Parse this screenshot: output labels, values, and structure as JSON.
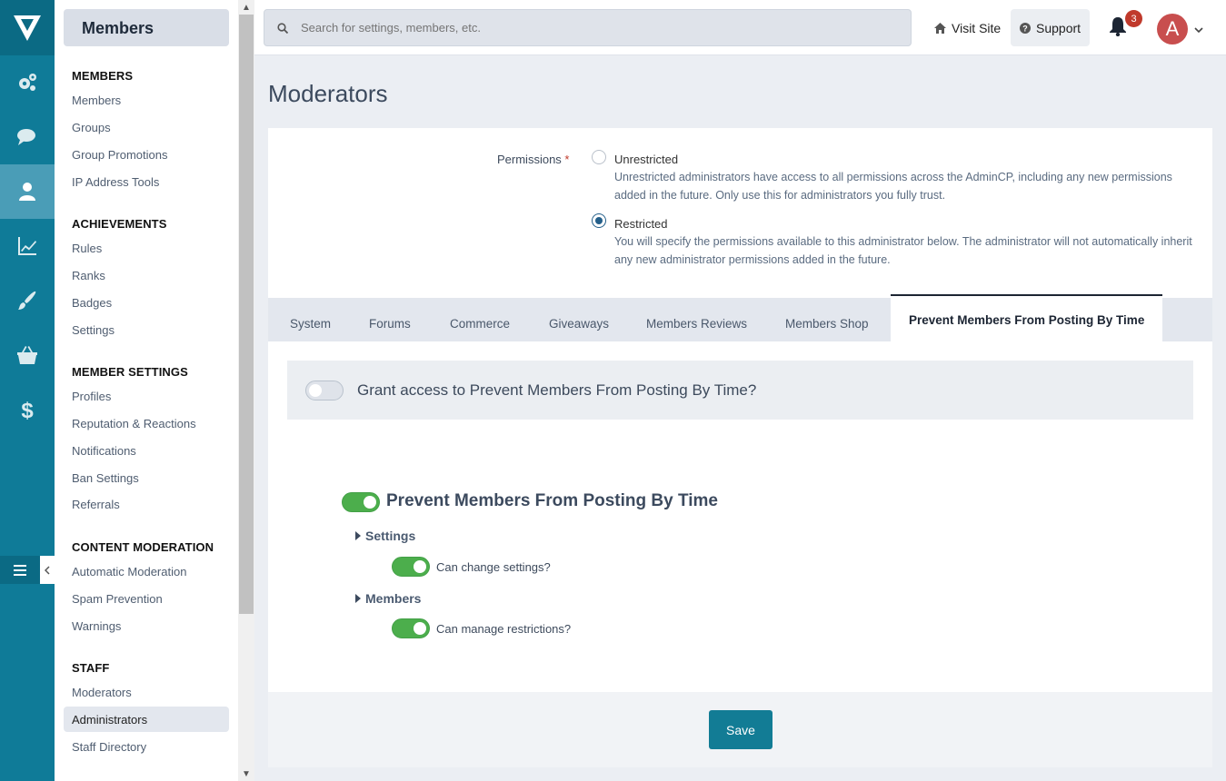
{
  "header": {
    "search_placeholder": "Search for settings, members, etc.",
    "visit_site": "Visit Site",
    "support": "Support",
    "notification_count": "3",
    "avatar_letter": "A"
  },
  "subnav": {
    "title": "Members",
    "sections": [
      {
        "heading": "MEMBERS",
        "items": [
          "Members",
          "Groups",
          "Group Promotions",
          "IP Address Tools"
        ]
      },
      {
        "heading": "ACHIEVEMENTS",
        "items": [
          "Rules",
          "Ranks",
          "Badges",
          "Settings"
        ]
      },
      {
        "heading": "MEMBER SETTINGS",
        "items": [
          "Profiles",
          "Reputation & Reactions",
          "Notifications",
          "Ban Settings",
          "Referrals"
        ]
      },
      {
        "heading": "CONTENT MODERATION",
        "items": [
          "Automatic Moderation",
          "Spam Prevention",
          "Warnings"
        ]
      },
      {
        "heading": "STAFF",
        "items": [
          "Moderators",
          "Administrators",
          "Staff Directory"
        ]
      }
    ],
    "active_item": "Administrators"
  },
  "page": {
    "title": "Moderators",
    "permissions_label": "Permissions",
    "required_mark": "*",
    "options": [
      {
        "title": "Unrestricted",
        "desc": "Unrestricted administrators have access to all permissions across the AdminCP, including any new permissions added in the future. Only use this for administrators you fully trust.",
        "checked": false
      },
      {
        "title": "Restricted",
        "desc": "You will specify the permissions available to this administrator below. The administrator will not automatically inherit any new administrator permissions added in the future.",
        "checked": true
      }
    ],
    "tabs": [
      "System",
      "Forums",
      "Commerce",
      "Giveaways",
      "Members Reviews",
      "Members Shop",
      "Prevent Members From Posting By Time"
    ],
    "active_tab": "Prevent Members From Posting By Time",
    "grant_label": "Grant access to Prevent Members From Posting By Time?",
    "grant_on": false,
    "app_name": "Prevent Members From Posting By Time",
    "groups": [
      {
        "name": "Settings",
        "perm": "Can change settings?",
        "on": true
      },
      {
        "name": "Members",
        "perm": "Can manage restrictions?",
        "on": true
      }
    ],
    "save_label": "Save"
  }
}
